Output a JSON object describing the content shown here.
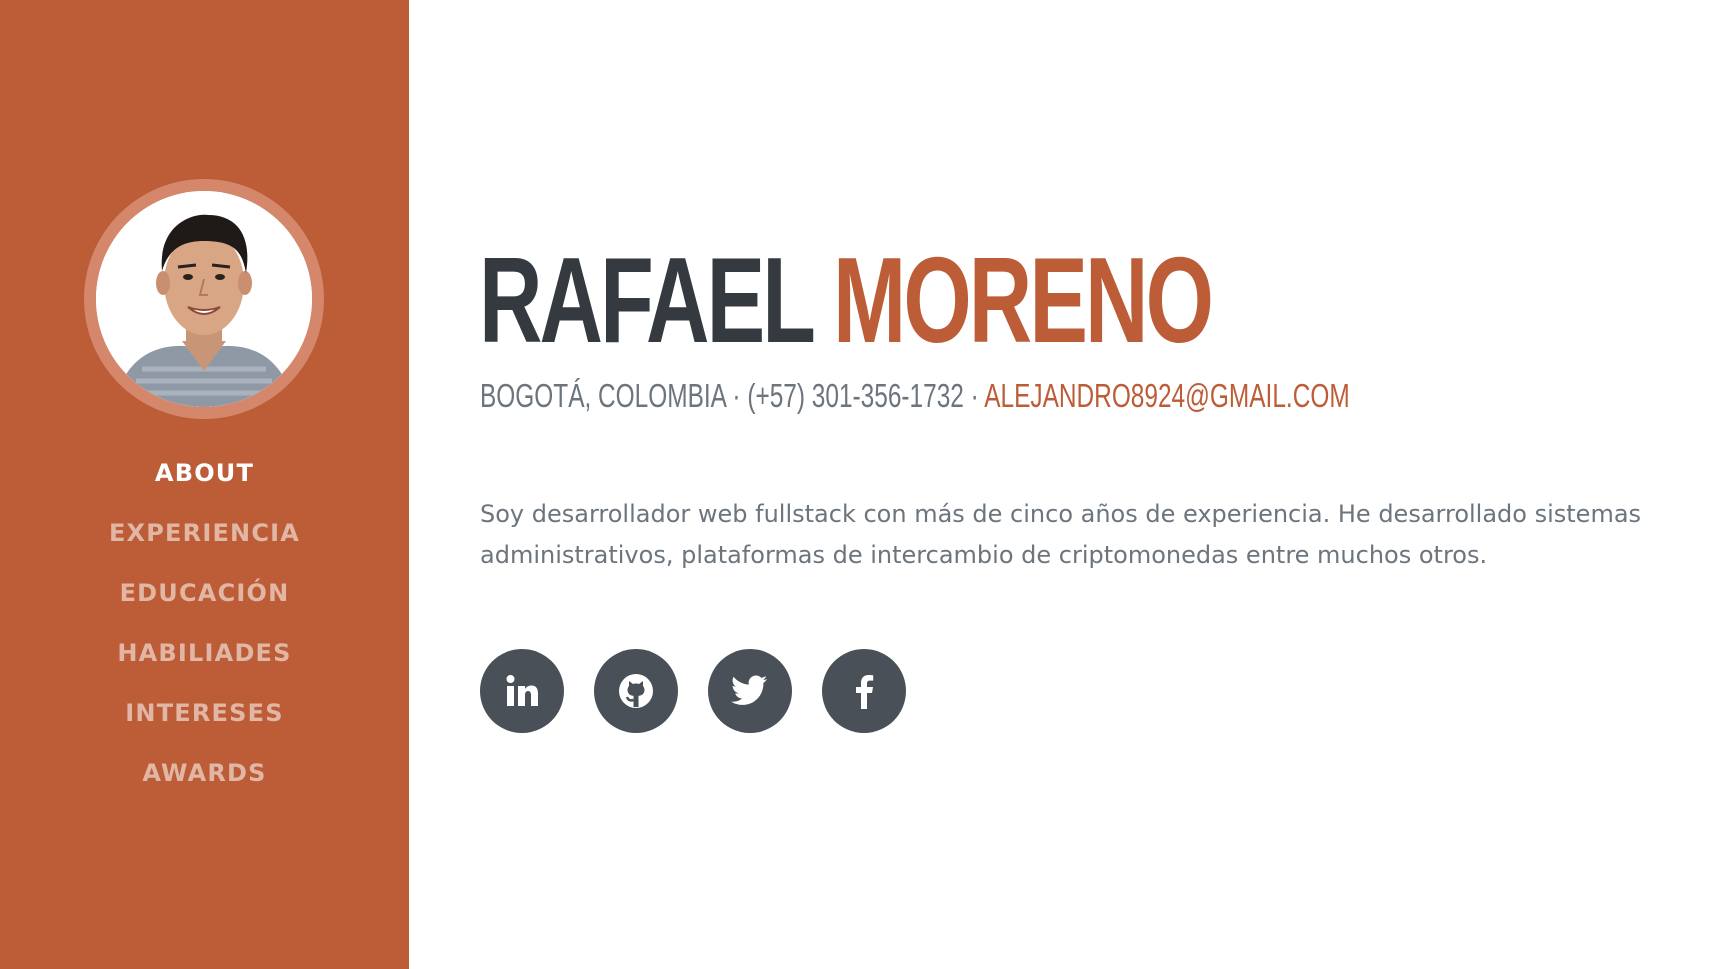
{
  "profile": {
    "first_name": "RAFAEL",
    "last_name": "MORENO",
    "location": "BOGOTÁ, COLOMBIA",
    "phone": "(+57) 301-356-1732",
    "separator": "·",
    "email": "ALEJANDRO8924@GMAIL.COM",
    "bio": "Soy desarrollador web fullstack con más de cinco años de experiencia. He desarrollado sistemas administrativos, plataformas de intercambio de criptomonedas entre muchos otros."
  },
  "sidebar": {
    "accent_color": "#bd5d38",
    "items": [
      {
        "label": "ABOUT",
        "active": true
      },
      {
        "label": "EXPERIENCIA",
        "active": false
      },
      {
        "label": "EDUCACIÓN",
        "active": false
      },
      {
        "label": "HABILIADES",
        "active": false
      },
      {
        "label": "INTERESES",
        "active": false
      },
      {
        "label": "AWARDS",
        "active": false
      }
    ]
  },
  "socials": [
    {
      "icon": "linkedin-icon"
    },
    {
      "icon": "github-icon"
    },
    {
      "icon": "twitter-icon"
    },
    {
      "icon": "facebook-icon"
    }
  ],
  "colors": {
    "dark_text": "#343a40",
    "muted_text": "#6c757d",
    "social_bg": "#495057"
  }
}
